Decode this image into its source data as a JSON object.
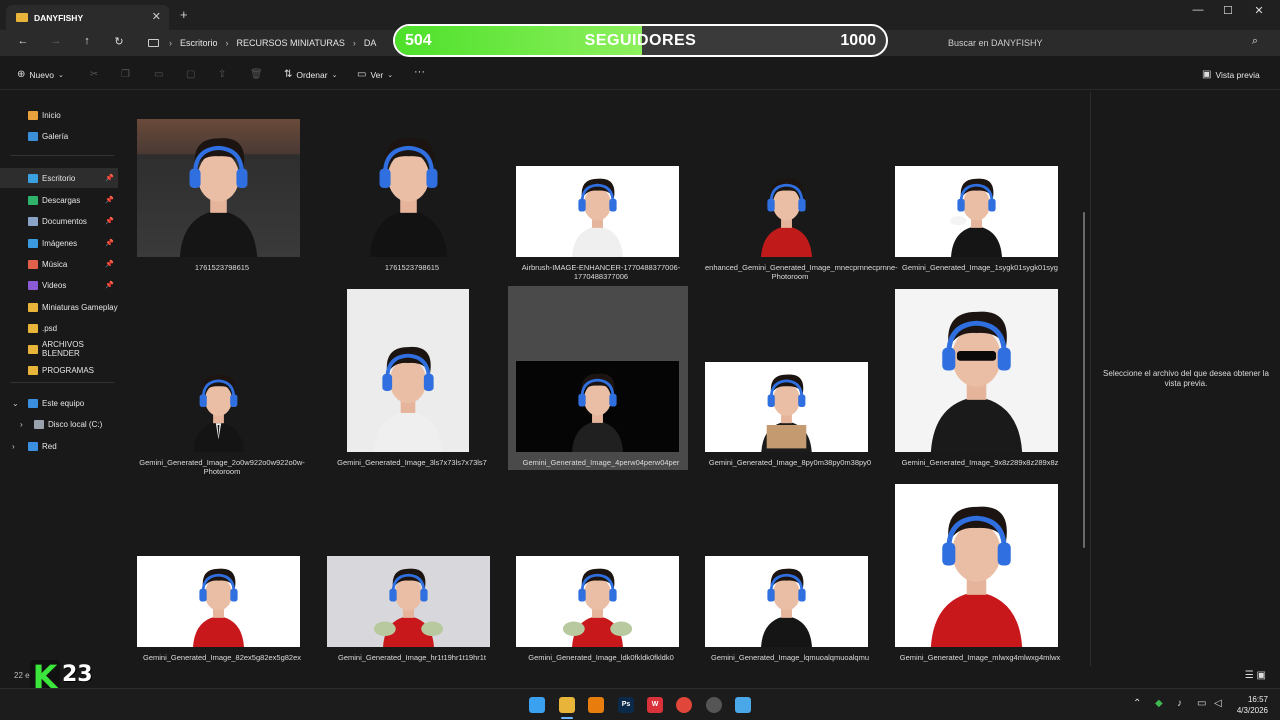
{
  "window": {
    "tab_title": "DANYFISHY",
    "tab_close": "✕",
    "new_tab": "+",
    "minimize": "—",
    "maximize": "☐",
    "close": "✕"
  },
  "address": {
    "breadcrumbs": [
      "Escritorio",
      "RECURSOS MINIATURAS",
      "DA"
    ],
    "search_placeholder": "Buscar en DANYFISHY"
  },
  "followers": {
    "current": "504",
    "label": "SEGUIDORES",
    "goal": "1000",
    "progress": 0.504,
    "color": "#4de02a"
  },
  "toolbar": {
    "new_label": "Nuevo",
    "sort_label": "Ordenar",
    "view_label": "Ver",
    "more": "···",
    "preview_label": "Vista previa"
  },
  "sidebar": {
    "items": [
      {
        "label": "Inicio",
        "icon": "home-icon",
        "color": "#e9a23b"
      },
      {
        "label": "Galería",
        "icon": "gallery-icon",
        "color": "#3b8fd9"
      },
      {
        "label": "Escritorio",
        "icon": "desktop-icon",
        "color": "#3aa0e0",
        "pinned": true,
        "selected": true
      },
      {
        "label": "Descargas",
        "icon": "download-icon",
        "color": "#2fb36a",
        "pinned": true
      },
      {
        "label": "Documentos",
        "icon": "documents-icon",
        "color": "#8aa4c8",
        "pinned": true
      },
      {
        "label": "Imágenes",
        "icon": "pictures-icon",
        "color": "#3b9be0",
        "pinned": true
      },
      {
        "label": "Música",
        "icon": "music-icon",
        "color": "#e0604a",
        "pinned": true
      },
      {
        "label": "Videos",
        "icon": "videos-icon",
        "color": "#8b5bd6",
        "pinned": true
      },
      {
        "label": "Miniaturas Gameplay",
        "icon": "folder-icon",
        "color": "#e8b43a"
      },
      {
        "label": ".psd",
        "icon": "folder-icon",
        "color": "#e8b43a"
      },
      {
        "label": "ARCHIVOS BLENDER",
        "icon": "folder-icon",
        "color": "#e8b43a"
      },
      {
        "label": "PROGRAMAS",
        "icon": "folder-icon",
        "color": "#e8b43a"
      }
    ],
    "this_pc": "Este equipo",
    "local_disk": "Disco local (C:)",
    "network": "Red"
  },
  "files": [
    {
      "name": "1761523798615",
      "kind": "desk"
    },
    {
      "name": "1761523798615",
      "kind": "dark"
    },
    {
      "name": "Airbrush-IMAGE-ENHANCER-1770488377006-1770488377006",
      "kind": "white"
    },
    {
      "name": "enhanced_Gemini_Generated_Image_mnecprnnecprnne-Photoroom",
      "kind": "red-dark"
    },
    {
      "name": "Gemini_Generated_Image_1sygk01sygk01syg",
      "kind": "controller"
    },
    {
      "name": "Gemini_Generated_Image_2o0w922o0w922o0w-Photoroom",
      "kind": "suit"
    },
    {
      "name": "Gemini_Generated_Image_3ls7x73ls7x73ls7",
      "kind": "white-shirt"
    },
    {
      "name": "Gemini_Generated_Image_4perw04perw04per",
      "kind": "black-shh"
    },
    {
      "name": "Gemini_Generated_Image_8py0m38py0m38py0",
      "kind": "sign"
    },
    {
      "name": "Gemini_Generated_Image_9x8z289x8z289x8z",
      "kind": "glasses"
    },
    {
      "name": "Gemini_Generated_Image_82ex5g82ex5g82ex",
      "kind": "red-shirt"
    },
    {
      "name": "Gemini_Generated_Image_hr1t19hr1t19hr1t",
      "kind": "money"
    },
    {
      "name": "Gemini_Generated_Image_ldk0fkldk0fkldk0",
      "kind": "money-white"
    },
    {
      "name": "Gemini_Generated_Image_lqmuoalqmuoalqmu",
      "kind": "shh"
    },
    {
      "name": "Gemini_Generated_Image_mlwxg4mlwxg4mlwx",
      "kind": "anime"
    }
  ],
  "preview": {
    "message": "Seleccione el archivo del que desea obtener la vista previa."
  },
  "status": {
    "count_text": "22 el"
  },
  "overlay_logo": {
    "letter": "K",
    "number": "23"
  },
  "taskbar": {
    "time": "16:57",
    "date": "4/3/2026",
    "apps": [
      {
        "name": "start-icon",
        "label": "",
        "color": "#3aa0f0"
      },
      {
        "name": "file-explorer-icon",
        "label": "",
        "color": "#e8b43a"
      },
      {
        "name": "blender-icon",
        "label": "",
        "color": "#e87d0d"
      },
      {
        "name": "photoshop-icon",
        "label": "Ps",
        "color": "#0b2a4a"
      },
      {
        "name": "wps-icon",
        "label": "W",
        "color": "#d9323a"
      },
      {
        "name": "chrome-icon",
        "label": "",
        "color": "#e0463a"
      },
      {
        "name": "obs-icon",
        "label": "",
        "color": "#555555"
      },
      {
        "name": "notepad-icon",
        "label": "",
        "color": "#4aa8e8"
      }
    ]
  }
}
